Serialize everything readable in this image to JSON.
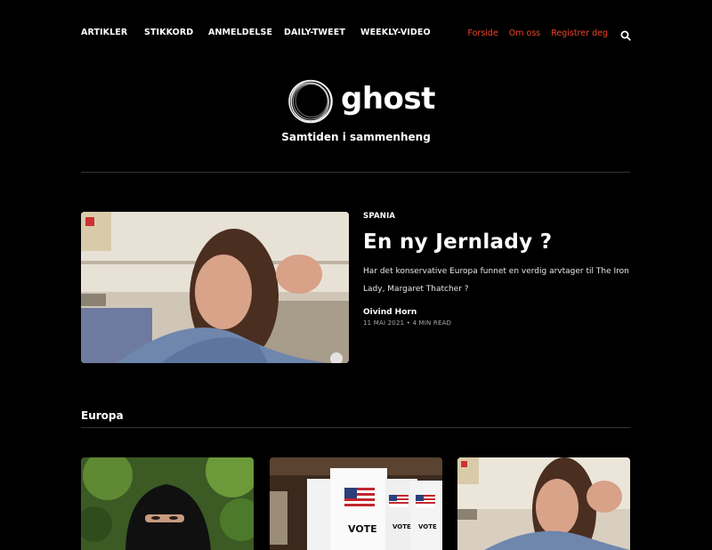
{
  "nav": {
    "left": [
      "ARTIKLER",
      "STIKKORD",
      "ANMELDELSE",
      "DAILY-TWEET",
      "WEEKLY-VIDEO"
    ],
    "right": [
      "Forside",
      "Om oss",
      "Registrer deg"
    ],
    "search_icon": "search-icon",
    "accent_color": "#f0452a"
  },
  "brand": {
    "name": "ghost",
    "tagline": "Samtiden i sammenheng"
  },
  "feature": {
    "tag": "SPANIA",
    "title": "En ny Jernlady ?",
    "excerpt": "Har det konservative Europa funnet en verdig arvtager til The Iron Lady, Margaret Thatcher ?",
    "author": "Oivind Horn",
    "meta": "11 MAI 2021 • 4 MIN READ"
  },
  "section": {
    "title": "Europa"
  },
  "cards": [
    {
      "image": "woman-in-niqab-photo"
    },
    {
      "image": "vote-booths-photo",
      "booth_text": "VOTE"
    },
    {
      "image": "woman-portrait-photo"
    }
  ]
}
